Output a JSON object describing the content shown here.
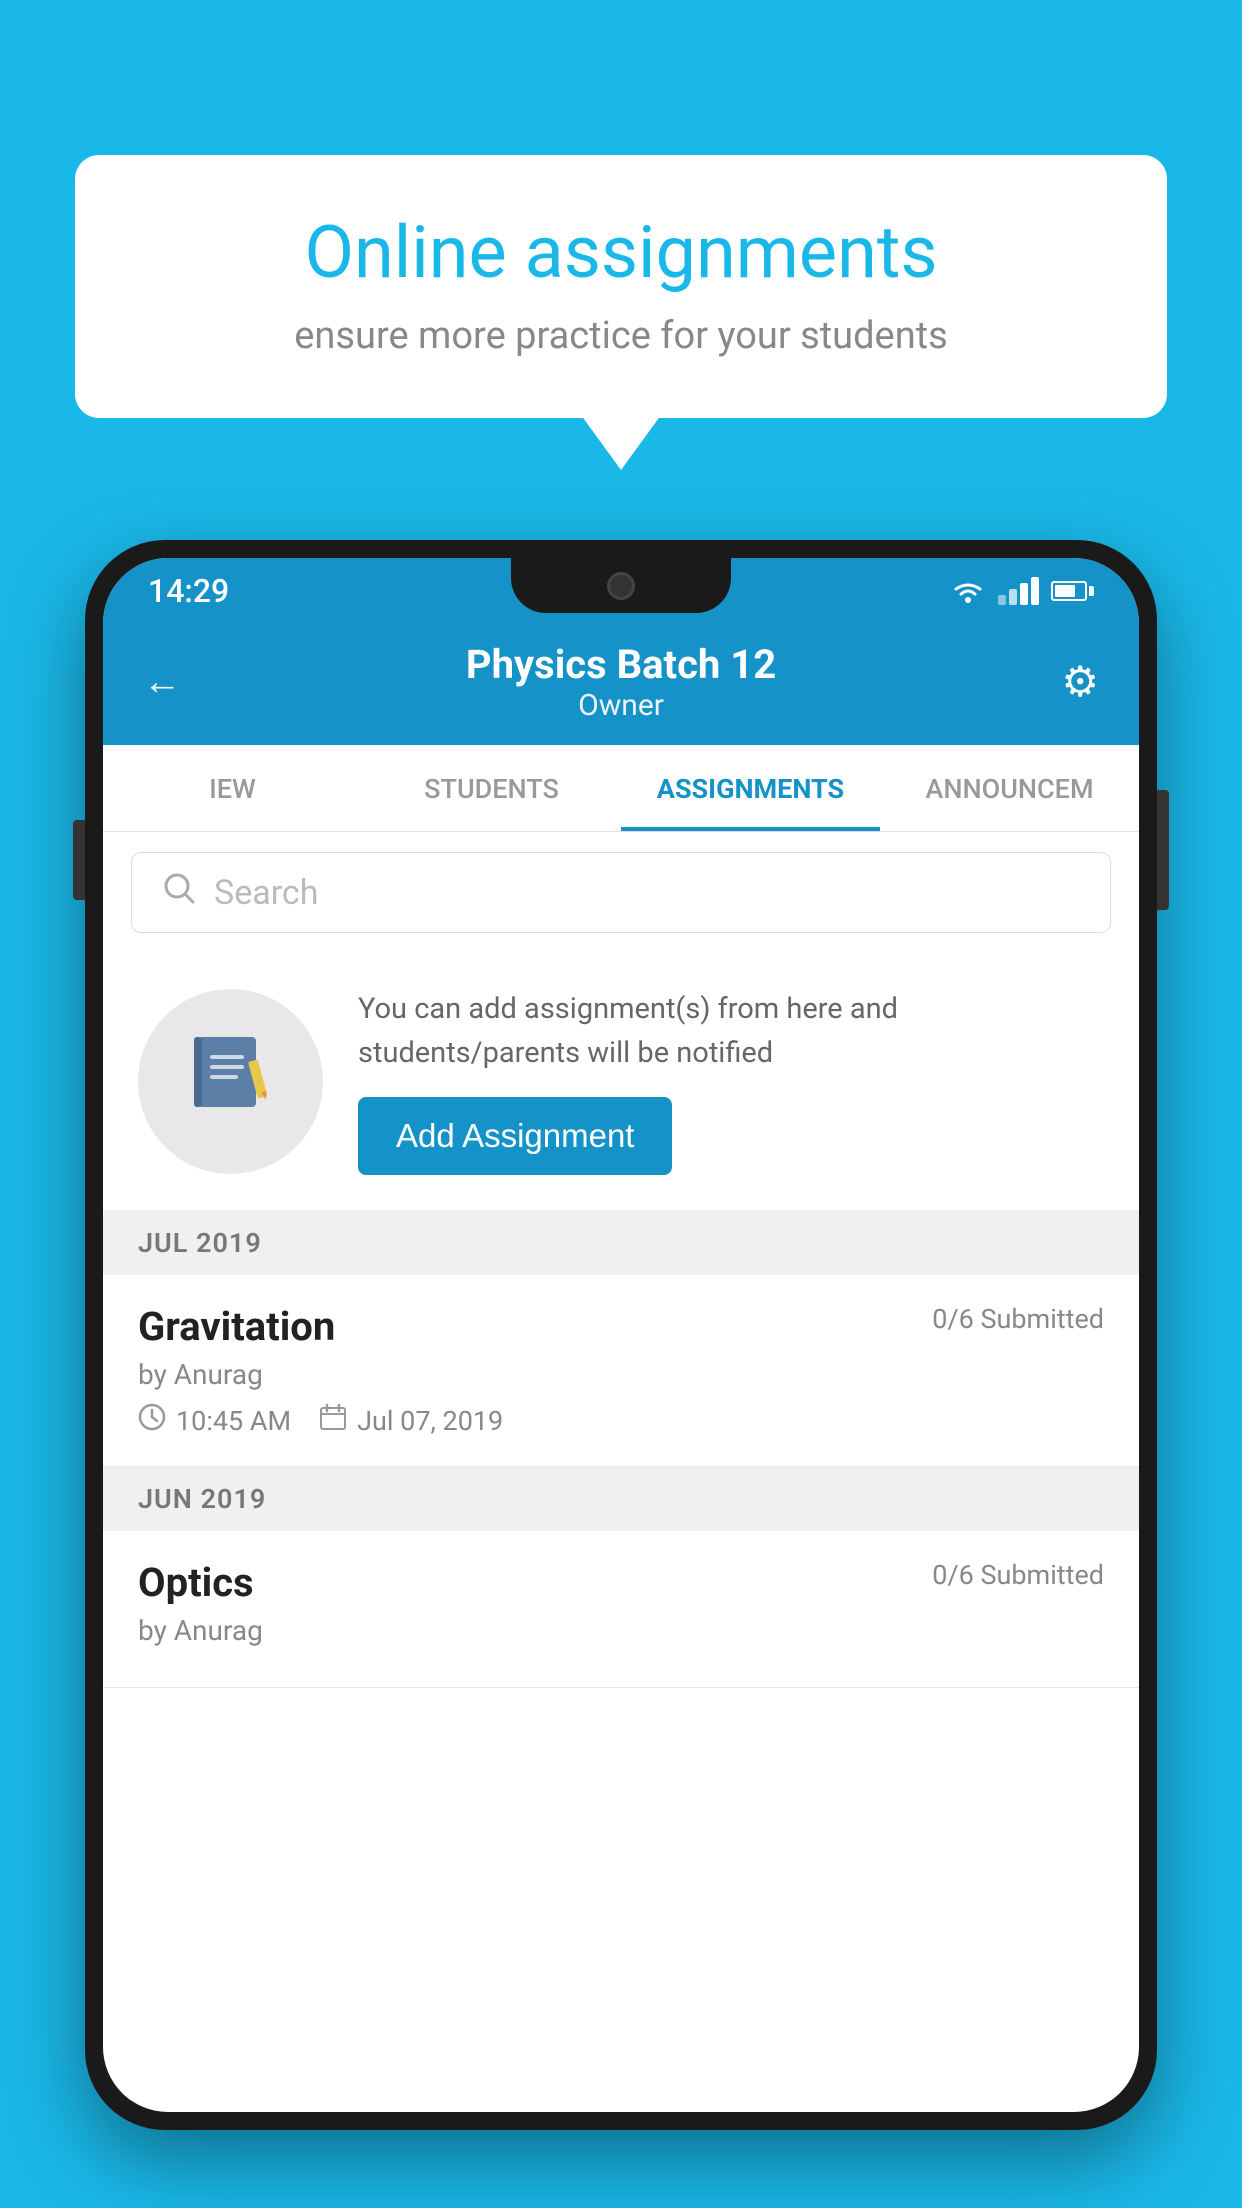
{
  "background_color": "#1ab8e8",
  "speech_bubble": {
    "title": "Online assignments",
    "subtitle": "ensure more practice for your students"
  },
  "phone": {
    "status_bar": {
      "time": "14:29"
    },
    "header": {
      "title": "Physics Batch 12",
      "subtitle": "Owner",
      "back_label": "←",
      "gear_label": "⚙"
    },
    "tabs": [
      {
        "label": "IEW",
        "active": false
      },
      {
        "label": "STUDENTS",
        "active": false
      },
      {
        "label": "ASSIGNMENTS",
        "active": true
      },
      {
        "label": "ANNOUNCEM",
        "active": false
      }
    ],
    "search": {
      "placeholder": "Search"
    },
    "info_card": {
      "text": "You can add assignment(s) from here and students/parents will be notified",
      "button_label": "Add Assignment"
    },
    "sections": [
      {
        "label": "JUL 2019",
        "assignments": [
          {
            "name": "Gravitation",
            "submitted": "0/6 Submitted",
            "by": "by Anurag",
            "time": "10:45 AM",
            "date": "Jul 07, 2019"
          }
        ]
      },
      {
        "label": "JUN 2019",
        "assignments": [
          {
            "name": "Optics",
            "submitted": "0/6 Submitted",
            "by": "by Anurag",
            "time": "",
            "date": ""
          }
        ]
      }
    ]
  }
}
